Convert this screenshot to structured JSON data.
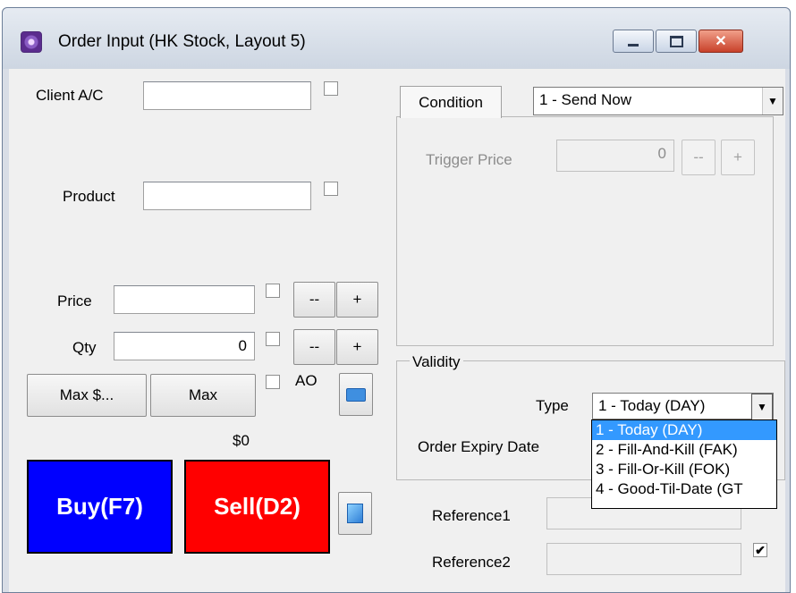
{
  "window": {
    "title": "Order Input (HK Stock, Layout 5)"
  },
  "form": {
    "client_label": "Client A/C",
    "product_label": "Product",
    "price_label": "Price",
    "qty_label": "Qty",
    "qty_value": "0",
    "minus": "--",
    "plus": "+",
    "max_dollar": "Max $...",
    "max": "Max",
    "ao_label": "AO",
    "amount": "$0",
    "buy": "Buy(F7)",
    "sell": "Sell(D2)"
  },
  "condition": {
    "tab_label": "Condition",
    "selected": "1 - Send Now",
    "trigger_label": "Trigger Price",
    "trigger_value": "0",
    "minus": "--",
    "plus": "+"
  },
  "validity": {
    "group_label": "Validity",
    "type_label": "Type",
    "type_selected": "1 - Today (DAY)",
    "expiry_label": "Order Expiry Date",
    "options": [
      "1 - Today (DAY)",
      "2 - Fill-And-Kill (FAK)",
      "3 - Fill-Or-Kill (FOK)",
      "4 - Good-Til-Date (GT"
    ]
  },
  "refs": {
    "ref1_label": "Reference1",
    "ref2_label": "Reference2"
  },
  "colors": {
    "buy": "#0000ff",
    "sell": "#ff0000",
    "selection": "#3399ff"
  },
  "icons": [
    "app-icon",
    "minimize-icon",
    "maximize-icon",
    "close-icon",
    "keyboard-icon",
    "notepad-icon",
    "checkmark-icon",
    "dropdown-arrow-icon"
  ]
}
